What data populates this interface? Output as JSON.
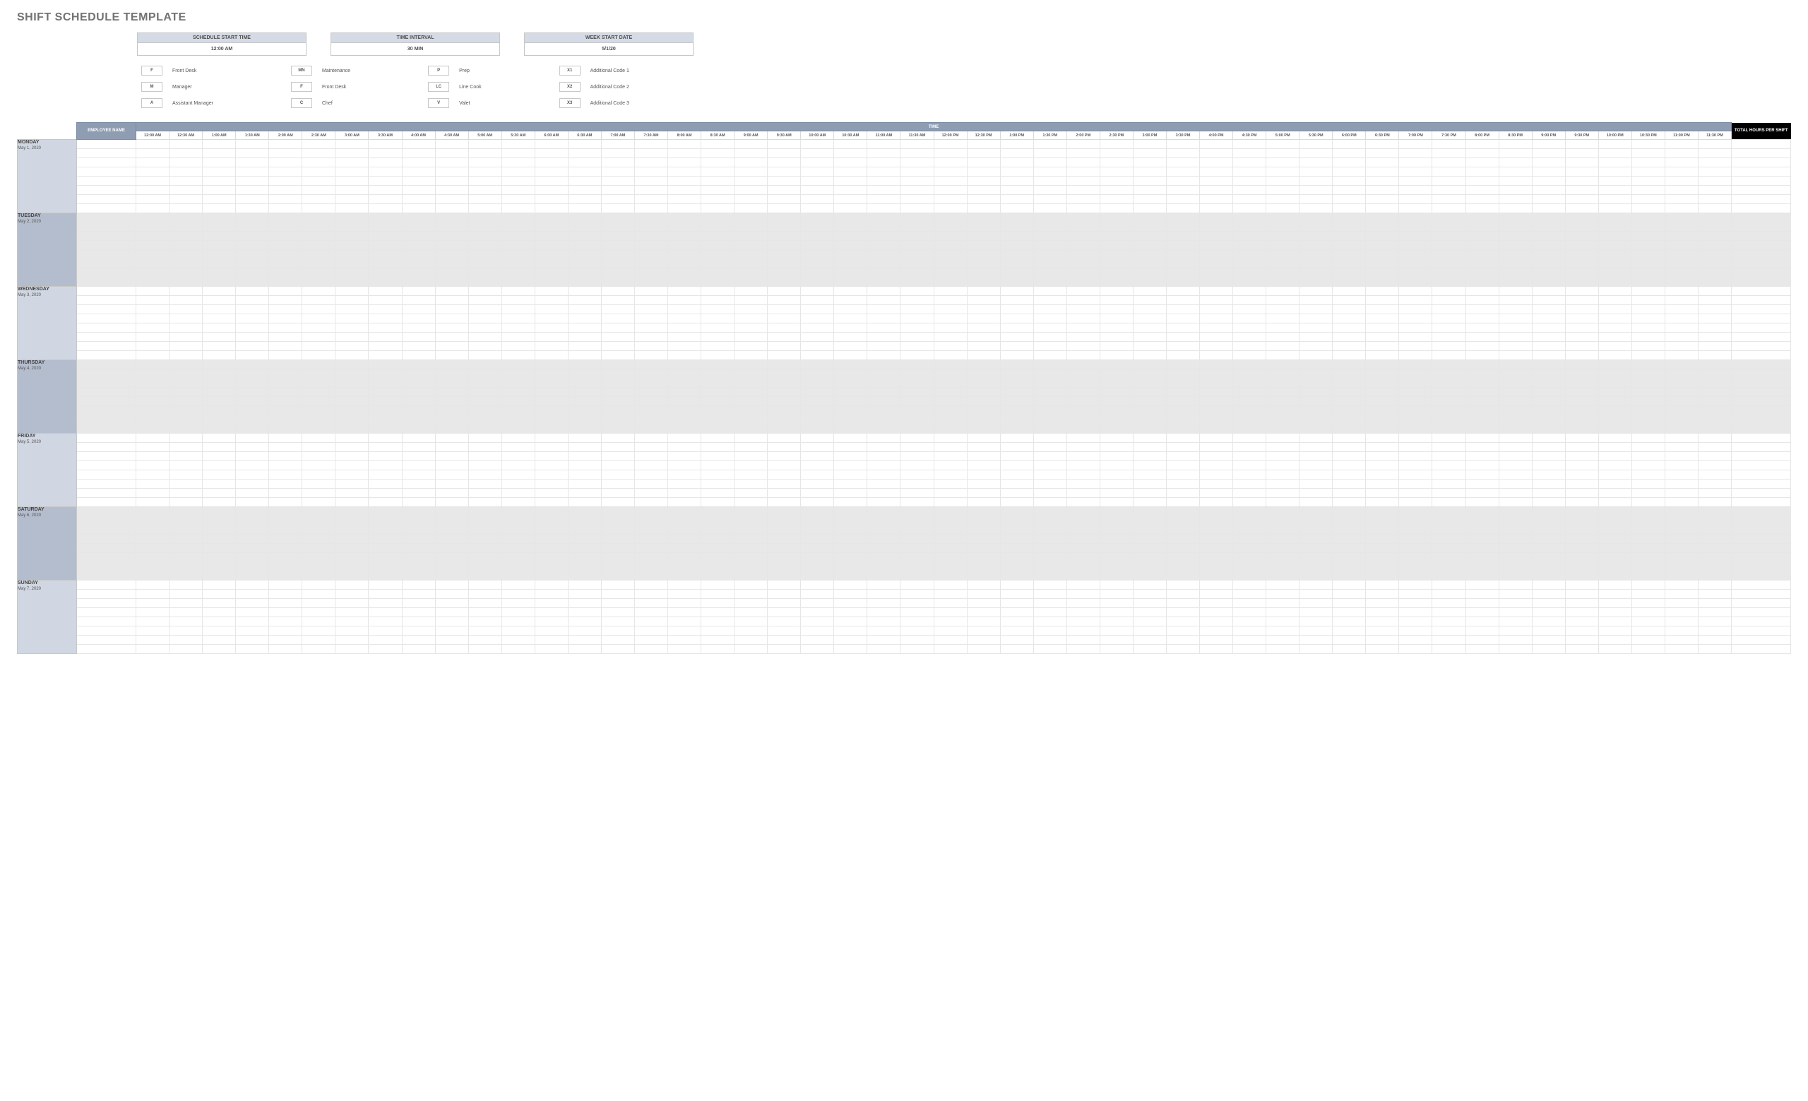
{
  "title": "SHIFT SCHEDULE TEMPLATE",
  "config": {
    "start_time_label": "SCHEDULE START TIME",
    "start_time_value": "12:00 AM",
    "interval_label": "TIME INTERVAL",
    "interval_value": "30 MIN",
    "week_start_label": "WEEK START DATE",
    "week_start_value": "5/1/20"
  },
  "legend": [
    [
      {
        "code": "F",
        "label": "Front Desk"
      },
      {
        "code": "M",
        "label": "Manager"
      },
      {
        "code": "A",
        "label": "Assistant Manager"
      }
    ],
    [
      {
        "code": "MN",
        "label": "Maintenance"
      },
      {
        "code": "F",
        "label": "Front Desk"
      },
      {
        "code": "C",
        "label": "Chef"
      }
    ],
    [
      {
        "code": "P",
        "label": "Prep"
      },
      {
        "code": "LC",
        "label": "Line Cook"
      },
      {
        "code": "V",
        "label": "Valet"
      }
    ],
    [
      {
        "code": "X1",
        "label": "Additional Code 1"
      },
      {
        "code": "X2",
        "label": "Additional Code 2"
      },
      {
        "code": "X3",
        "label": "Additional Code 3"
      }
    ]
  ],
  "headers": {
    "employee": "EMPLOYEE NAME",
    "time": "TIME",
    "total": "TOTAL HOURS PER SHIFT"
  },
  "time_columns": [
    "12:00 AM",
    "12:30 AM",
    "1:00 AM",
    "1:30 AM",
    "2:00 AM",
    "2:30 AM",
    "3:00 AM",
    "3:30 AM",
    "4:00 AM",
    "4:30 AM",
    "5:00 AM",
    "5:30 AM",
    "6:00 AM",
    "6:30 AM",
    "7:00 AM",
    "7:30 AM",
    "8:00 AM",
    "8:30 AM",
    "9:00 AM",
    "9:30 AM",
    "10:00 AM",
    "10:30 AM",
    "11:00 AM",
    "11:30 AM",
    "12:00 PM",
    "12:30 PM",
    "1:00 PM",
    "1:30 PM",
    "2:00 PM",
    "2:30 PM",
    "3:00 PM",
    "3:30 PM",
    "4:00 PM",
    "4:30 PM",
    "5:00 PM",
    "5:30 PM",
    "6:00 PM",
    "6:30 PM",
    "7:00 PM",
    "7:30 PM",
    "8:00 PM",
    "8:30 PM",
    "9:00 PM",
    "9:30 PM",
    "10:00 PM",
    "10:30 PM",
    "11:00 PM",
    "11:30 PM"
  ],
  "days": [
    {
      "name": "MONDAY",
      "date": "May 1, 2020",
      "alt": false,
      "rows": 8
    },
    {
      "name": "TUESDAY",
      "date": "May 2, 2020",
      "alt": true,
      "rows": 8
    },
    {
      "name": "WEDNESDAY",
      "date": "May 3, 2020",
      "alt": false,
      "rows": 8
    },
    {
      "name": "THURSDAY",
      "date": "May 4, 2020",
      "alt": true,
      "rows": 8
    },
    {
      "name": "FRIDAY",
      "date": "May 5, 2020",
      "alt": false,
      "rows": 8
    },
    {
      "name": "SATURDAY",
      "date": "May 6, 2020",
      "alt": true,
      "rows": 8
    },
    {
      "name": "SUNDAY",
      "date": "May 7, 2020",
      "alt": false,
      "rows": 8
    }
  ]
}
